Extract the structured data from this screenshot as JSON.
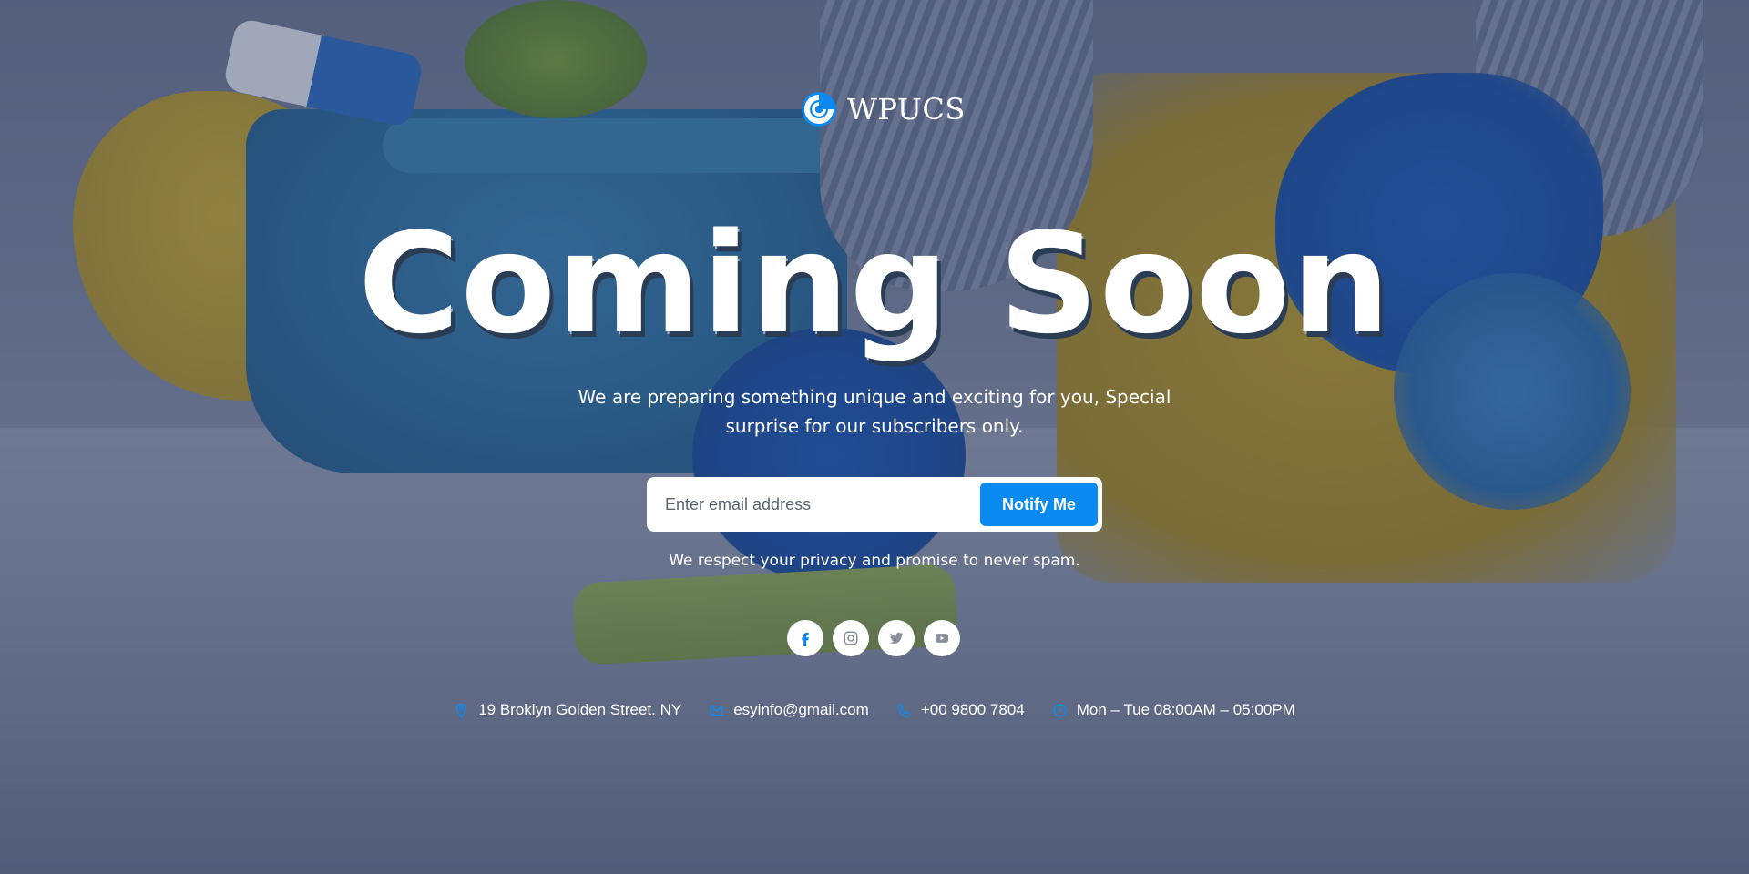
{
  "brand": {
    "name": "WPUCS",
    "accent": "#0b8bf2"
  },
  "hero": {
    "title": "Coming Soon",
    "subtitle": "We are preparing something unique and exciting for you, Special surprise for our subscribers only."
  },
  "subscribe": {
    "placeholder": "Enter email address",
    "button_label": "Notify Me",
    "privacy_note": "We respect your privacy and promise to never spam."
  },
  "social": [
    {
      "icon": "facebook-icon"
    },
    {
      "icon": "instagram-icon"
    },
    {
      "icon": "twitter-icon"
    },
    {
      "icon": "youtube-icon"
    }
  ],
  "contact": {
    "address": "19 Broklyn Golden Street. NY",
    "email": "esyinfo@gmail.com",
    "phone": "+00 9800 7804",
    "hours": "Mon – Tue 08:00AM – 05:00PM"
  }
}
